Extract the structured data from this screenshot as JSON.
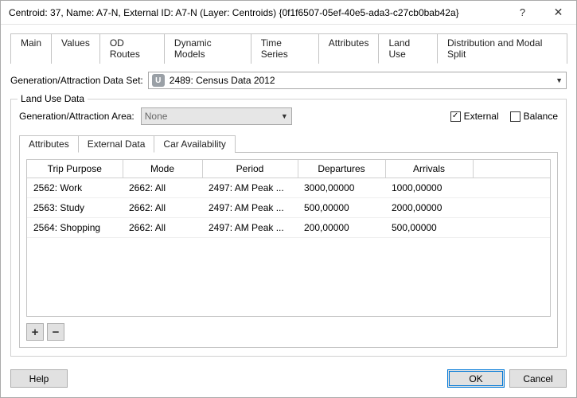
{
  "window": {
    "title": "Centroid: 37, Name: A7-N, External ID: A7-N (Layer: Centroids) {0f1f6507-05ef-40e5-ada3-c27cb0bab42a}"
  },
  "tabs": {
    "items": [
      "Main",
      "Values",
      "OD Routes",
      "Dynamic Models",
      "Time Series",
      "Attributes",
      "Land Use",
      "Distribution and Modal Split"
    ],
    "active": "Land Use"
  },
  "dataset": {
    "label": "Generation/Attraction Data Set:",
    "value": "2489: Census Data 2012"
  },
  "group": {
    "title": "Land Use Data",
    "area_label": "Generation/Attraction Area:",
    "area_value": "None",
    "external": {
      "label": "External",
      "checked": true
    },
    "balance": {
      "label": "Balance",
      "checked": false
    }
  },
  "inner_tabs": {
    "items": [
      "Attributes",
      "External Data",
      "Car Availability"
    ],
    "active": "External Data"
  },
  "table": {
    "columns": [
      "Trip Purpose",
      "Mode",
      "Period",
      "Departures",
      "Arrivals"
    ],
    "rows": [
      {
        "purpose": "2562: Work",
        "mode": "2662: All",
        "period": "2497: AM Peak ...",
        "dep": "3000,00000",
        "arr": "1000,00000"
      },
      {
        "purpose": "2563: Study",
        "mode": "2662: All",
        "period": "2497: AM Peak ...",
        "dep": "500,00000",
        "arr": "2000,00000"
      },
      {
        "purpose": "2564: Shopping",
        "mode": "2662: All",
        "period": "2497: AM Peak ...",
        "dep": "200,00000",
        "arr": "500,00000"
      }
    ]
  },
  "footer": {
    "help": "Help",
    "ok": "OK",
    "cancel": "Cancel"
  },
  "icons": {
    "add": "+",
    "remove": "−",
    "help": "?",
    "close": "✕",
    "check": "✓",
    "dropdown": "▼",
    "dataset_badge": "U"
  }
}
